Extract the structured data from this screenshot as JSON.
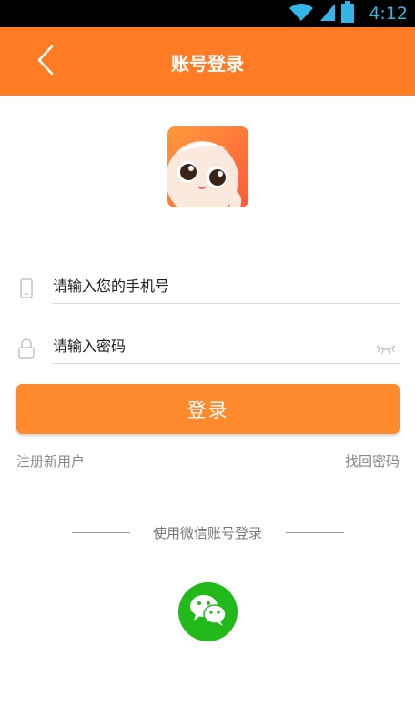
{
  "status_bar": {
    "time": "4:12",
    "icons": [
      "wifi-icon",
      "signal-icon",
      "battery-icon"
    ],
    "time_color": "#33b5e5"
  },
  "header": {
    "title": "账号登录",
    "back_icon": "chevron-left-icon",
    "background": "#ff7b24"
  },
  "logo": {
    "icon": "app-logo-mascot"
  },
  "form": {
    "phone": {
      "placeholder": "请输入您的手机号",
      "value": "",
      "icon": "phone-icon"
    },
    "password": {
      "placeholder": "请输入密码",
      "value": "",
      "icon": "lock-icon",
      "toggle_icon": "eye-closed-icon"
    },
    "login_label": "登录",
    "login_color": "#ff8a2e"
  },
  "links": {
    "register": "注册新用户",
    "forgot_password": "找回密码"
  },
  "wechat": {
    "divider_text": "使用微信账号登录",
    "icon": "wechat-icon",
    "color": "#22b91a"
  }
}
